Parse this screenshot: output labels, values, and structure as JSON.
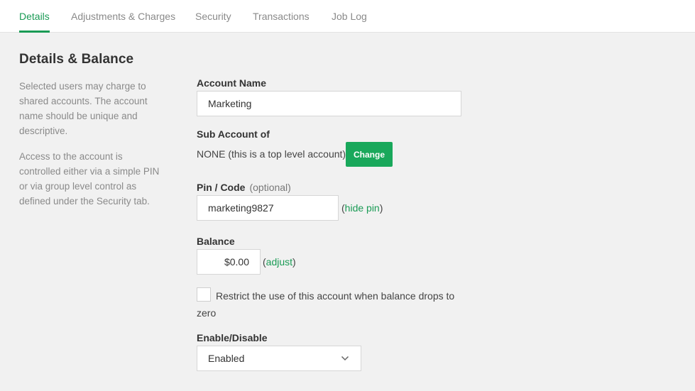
{
  "tabs": [
    {
      "label": "Details",
      "active": true
    },
    {
      "label": "Adjustments & Charges",
      "active": false
    },
    {
      "label": "Security",
      "active": false
    },
    {
      "label": "Transactions",
      "active": false
    },
    {
      "label": "Job Log",
      "active": false
    }
  ],
  "section": {
    "title": "Details & Balance",
    "desc1": "Selected users may charge to shared accounts. The account name should be unique and descriptive.",
    "desc2": "Access to the account is controlled either via a simple PIN or via group level control as defined under the Security tab."
  },
  "form": {
    "account_name_label": "Account Name",
    "account_name_value": "Marketing",
    "sub_account_label": "Sub Account of",
    "sub_account_value": "NONE (this is a top level account)",
    "change_button": "Change",
    "pin_label": "Pin / Code",
    "pin_optional": "(optional)",
    "pin_value": "marketing9827",
    "hide_pin_open": "(",
    "hide_pin_link": "hide pin",
    "hide_pin_close": ")",
    "balance_label": "Balance",
    "balance_value": "$0.00",
    "adjust_open": "(",
    "adjust_link": "adjust",
    "adjust_close": ")",
    "restrict_text": "Restrict the use of this account when balance drops to zero",
    "restrict_checked": false,
    "enable_label": "Enable/Disable",
    "enable_value": "Enabled"
  },
  "colors": {
    "accent": "#1a9b55",
    "button": "#19a85b",
    "background": "#f1f1f1"
  }
}
